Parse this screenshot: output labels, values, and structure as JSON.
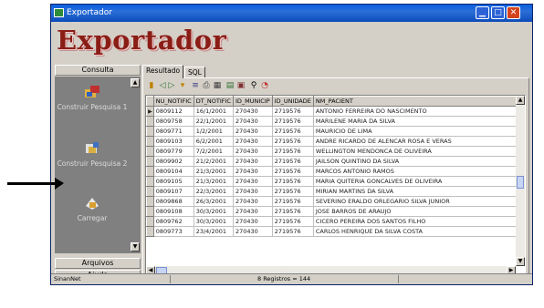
{
  "window": {
    "title": "Exportador"
  },
  "logo": {
    "text": "Exportador"
  },
  "sidebar": {
    "header": "Consulta",
    "items": [
      {
        "label": "Construir Pesquisa 1",
        "icon": "query-builder-icon"
      },
      {
        "label": "Construir Pesquisa 2",
        "icon": "query-builder-icon"
      },
      {
        "label": "Carregar",
        "icon": "load-icon"
      }
    ],
    "footer": [
      "Arquivos",
      "Ajuda"
    ]
  },
  "tabs": [
    {
      "label": "Resultado"
    },
    {
      "label": "SQL"
    }
  ],
  "grid": {
    "columns": [
      "NU_NOTIFIC",
      "DT_NOTIFIC",
      "ID_MUNICIP",
      "ID_UNIDADE",
      "NM_PACIENT"
    ],
    "rows": [
      [
        "0809112",
        "16/1/2001",
        "270430",
        "2719576",
        "ANTONIO FERREIRA DO NASCIMENTO"
      ],
      [
        "0809758",
        "22/1/2001",
        "270430",
        "2719576",
        "MARILENE MARIA DA SILVA"
      ],
      [
        "0809771",
        "1/2/2001",
        "270430",
        "2719576",
        "MAURICIO DE LIMA"
      ],
      [
        "0809103",
        "6/2/2001",
        "270430",
        "2719576",
        "ANDRE RICARDO DE ALENCAR  ROSA E VERAS"
      ],
      [
        "0809779",
        "7/2/2001",
        "270430",
        "2719576",
        "WELLINGTON MENDONCA DE OLIVEIRA"
      ],
      [
        "0809902",
        "21/2/2001",
        "270430",
        "2719576",
        "JAILSON QUINTINO DA SILVA"
      ],
      [
        "0809104",
        "21/3/2001",
        "270430",
        "2719576",
        "MARCOS ANTONIO RAMOS"
      ],
      [
        "0809105",
        "21/3/2001",
        "270430",
        "2719576",
        "MARIA QUITERIA GONCALVES DE OLIVEIRA"
      ],
      [
        "0809107",
        "22/3/2001",
        "270430",
        "2719576",
        "MIRIAN MARTINS DA SILVA"
      ],
      [
        "0809868",
        "26/3/2001",
        "270430",
        "2719576",
        "SEVERINO ERALDO ORLEGARIO SILVA JUNIOR"
      ],
      [
        "0809108",
        "30/3/2001",
        "270430",
        "2719576",
        "JOSE BARROS DE ARAUJO"
      ],
      [
        "0809762",
        "30/3/2001",
        "270430",
        "2719576",
        "CICERO PEREIRA DOS SANTOS FILHO"
      ],
      [
        "0809773",
        "23/4/2001",
        "270430",
        "2719576",
        "CARLOS HENRIQUE DA SILVA COSTA"
      ]
    ],
    "selected_row": 0
  },
  "statusbar": {
    "left": "SinanNet",
    "center": "8 Registros = 144"
  },
  "colors": {
    "titlebar": "#0a5fe0",
    "logo": "#8a1d15",
    "sidebar_panel": "#808080",
    "chrome": "#d4d0c8"
  }
}
